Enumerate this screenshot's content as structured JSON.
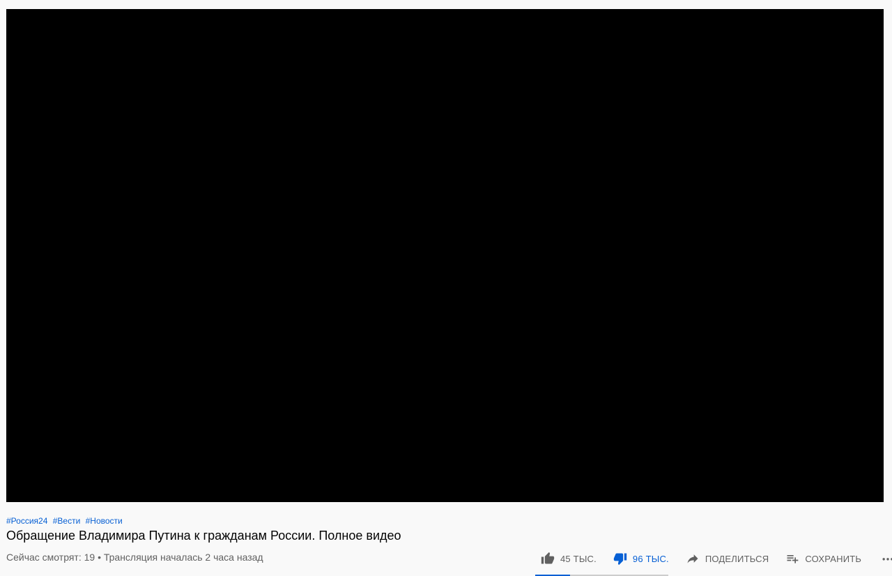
{
  "player": {
    "state": "black-screen"
  },
  "hashtags": [
    "#Россия24",
    "#Вести",
    "#Новости"
  ],
  "title": "Обращение Владимира Путина к гражданам России. Полное видео",
  "meta": "Сейчас смотрят: 19 • Трансляция началась 2 часа назад",
  "actions": {
    "like": {
      "label": "45 ТЫС.",
      "icon": "thumb-up-icon"
    },
    "dislike": {
      "label": "96 ТЫС.",
      "icon": "thumb-down-icon",
      "active": true
    },
    "share": {
      "label": "ПОДЕЛИТЬСЯ",
      "icon": "share-icon"
    },
    "save": {
      "label": "СОХРАНИТЬ",
      "icon": "playlist-add-icon"
    },
    "more": {
      "icon": "more-horizontal-icon"
    }
  },
  "sentiment": {
    "like_fraction": 0.26
  },
  "colors": {
    "accent": "#065fd4",
    "secondary_text": "#606060",
    "primary_text": "#030303",
    "background": "#f9f9f9"
  }
}
